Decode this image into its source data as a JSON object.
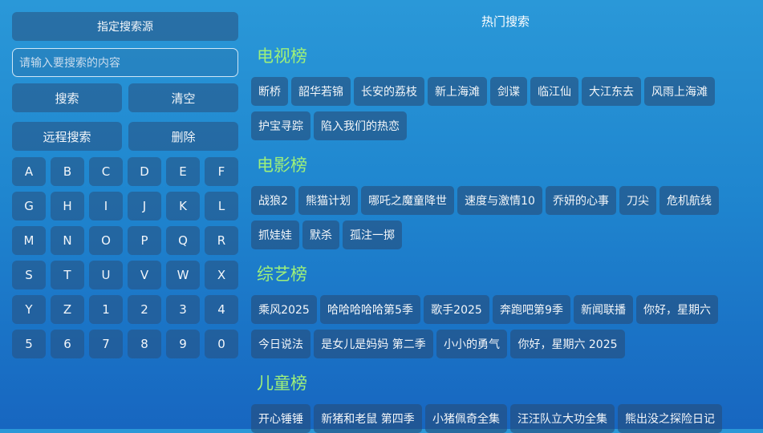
{
  "left": {
    "source_button": "指定搜索源",
    "search_placeholder": "请输入要搜索的内容",
    "search_button": "搜索",
    "clear_button": "清空",
    "remote_search_button": "远程搜索",
    "delete_button": "删除",
    "keys": [
      "A",
      "B",
      "C",
      "D",
      "E",
      "F",
      "G",
      "H",
      "I",
      "J",
      "K",
      "L",
      "M",
      "N",
      "O",
      "P",
      "Q",
      "R",
      "S",
      "T",
      "U",
      "V",
      "W",
      "X",
      "Y",
      "Z",
      "1",
      "2",
      "3",
      "4",
      "5",
      "6",
      "7",
      "8",
      "9",
      "0"
    ]
  },
  "right": {
    "title": "热门搜索",
    "sections": [
      {
        "title": "电视榜",
        "items": [
          "断桥",
          "韶华若锦",
          "长安的荔枝",
          "新上海滩",
          "剑谍",
          "临江仙",
          "大江东去",
          "风雨上海滩",
          "护宝寻踪",
          "陷入我们的热恋"
        ]
      },
      {
        "title": "电影榜",
        "items": [
          "战狼2",
          "熊猫计划",
          "哪吒之魔童降世",
          "速度与激情10",
          "乔妍的心事",
          "刀尖",
          "危机航线",
          "抓娃娃",
          "默杀",
          "孤注一掷"
        ]
      },
      {
        "title": "综艺榜",
        "items": [
          "乘风2025",
          "哈哈哈哈哈第5季",
          "歌手2025",
          "奔跑吧第9季",
          "新闻联播",
          "你好，星期六",
          "今日说法",
          "是女儿是妈妈 第二季",
          "小小的勇气",
          "你好，星期六 2025"
        ]
      },
      {
        "title": "儿童榜",
        "items": [
          "开心锤锤",
          "新猪和老鼠 第四季",
          "小猪佩奇全集",
          "汪汪队立大功全集",
          "熊出没之探险日记"
        ]
      }
    ]
  }
}
